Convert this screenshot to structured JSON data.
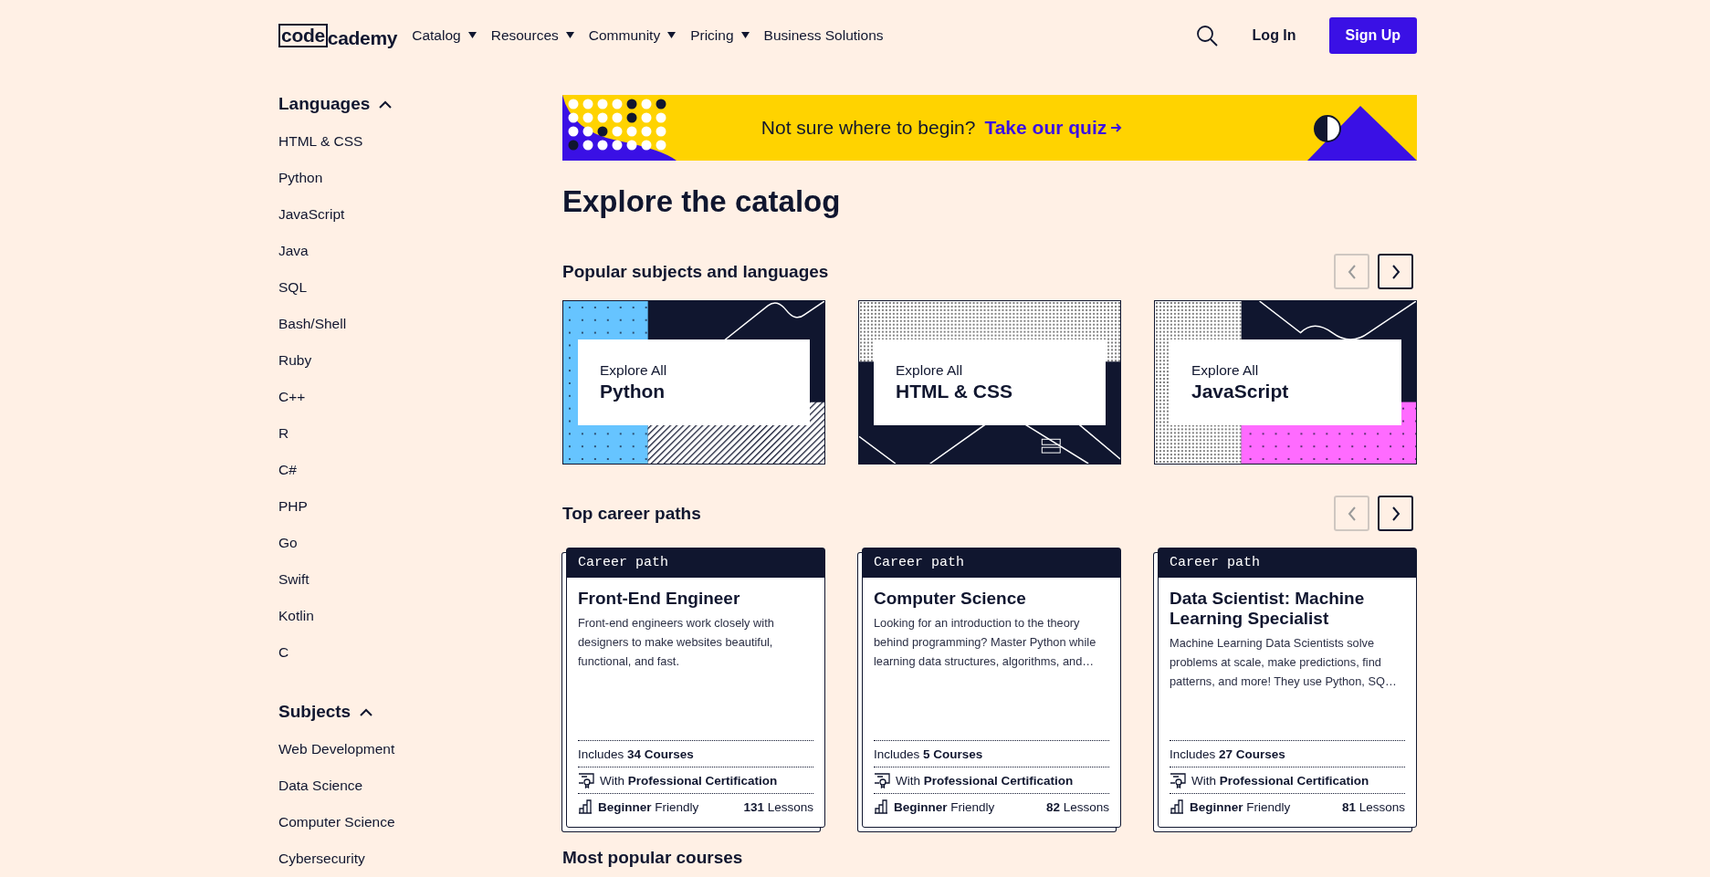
{
  "header": {
    "logo": {
      "boxed": "code",
      "rest": "cademy"
    },
    "nav": [
      {
        "label": "Catalog",
        "has_menu": true
      },
      {
        "label": "Resources",
        "has_menu": true
      },
      {
        "label": "Community",
        "has_menu": true
      },
      {
        "label": "Pricing",
        "has_menu": true
      },
      {
        "label": "Business Solutions",
        "has_menu": false
      }
    ],
    "login": "Log In",
    "signup": "Sign Up"
  },
  "sidebar": {
    "sections": [
      {
        "title": "Languages",
        "expanded": true,
        "items": [
          "HTML & CSS",
          "Python",
          "JavaScript",
          "Java",
          "SQL",
          "Bash/Shell",
          "Ruby",
          "C++",
          "R",
          "C#",
          "PHP",
          "Go",
          "Swift",
          "Kotlin",
          "C"
        ]
      },
      {
        "title": "Subjects",
        "expanded": true,
        "items": [
          "Web Development",
          "Data Science",
          "Computer Science",
          "Cybersecurity"
        ]
      }
    ]
  },
  "banner": {
    "text": "Not sure where to begin?",
    "link": "Take our quiz"
  },
  "page_title": "Explore the catalog",
  "popular": {
    "title": "Popular subjects and languages",
    "controls": [
      {
        "kind": "prev",
        "disabled": true
      },
      {
        "kind": "next",
        "disabled": false
      }
    ],
    "cards": [
      {
        "kind": "python",
        "kicker": "Explore All",
        "name": "Python"
      },
      {
        "kind": "html",
        "kicker": "Explore All",
        "name": "HTML & CSS"
      },
      {
        "kind": "javascript",
        "kicker": "Explore All",
        "name": "JavaScript"
      }
    ]
  },
  "career": {
    "title": "Top career paths",
    "controls": [
      {
        "kind": "prev",
        "disabled": true
      },
      {
        "kind": "next",
        "disabled": false
      }
    ],
    "cards": [
      {
        "tag": "Career path",
        "title": "Front-End Engineer",
        "description": "Front-end engineers work closely with designers to make websites beautiful, functional, and fast.",
        "includes": "Includes **34 Courses**",
        "certification": "With **Professional Certification**",
        "difficulty": "**Beginner** Friendly",
        "lessons": "**131** Lessons"
      },
      {
        "tag": "Career path",
        "title": "Computer Science",
        "description": "Looking for an introduction to the theory behind programming? Master Python while learning data structures, algorithms, and…",
        "includes": "Includes **5 Courses**",
        "certification": "With **Professional Certification**",
        "difficulty": "**Beginner** Friendly",
        "lessons": "**82** Lessons"
      },
      {
        "tag": "Career path",
        "title": "Data Scientist: Machine Learning Specialist",
        "description": "Machine Learning Data Scientists solve problems at scale, make predictions, find patterns, and more! They use Python, SQ…",
        "includes": "Includes **27 Courses**",
        "certification": "With **Professional Certification**",
        "difficulty": "**Beginner** Friendly",
        "lessons": "**81** Lessons"
      }
    ]
  },
  "next_section": "Most popular courses"
}
